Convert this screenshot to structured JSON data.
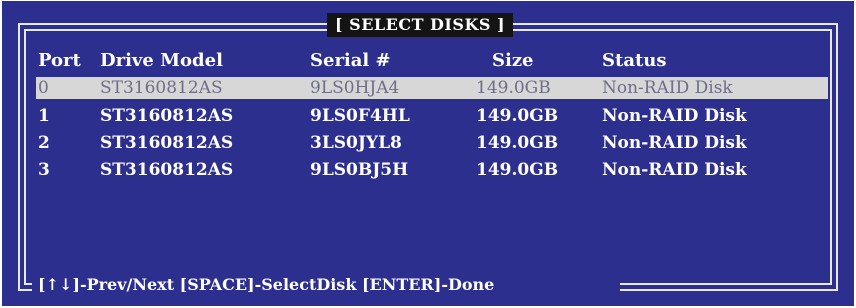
{
  "dialog": {
    "title": "[ SELECT DISKS ]"
  },
  "table": {
    "headers": {
      "port": "Port",
      "model": "Drive Model",
      "serial": "Serial #",
      "size": "Size",
      "status": "Status"
    },
    "rows": [
      {
        "port": "0",
        "model": "ST3160812AS",
        "serial": "9LS0HJA4",
        "size": "149.0GB",
        "status": "Non-RAID Disk",
        "selected": true
      },
      {
        "port": "1",
        "model": "ST3160812AS",
        "serial": "9LS0F4HL",
        "size": "149.0GB",
        "status": "Non-RAID Disk",
        "selected": false
      },
      {
        "port": "2",
        "model": "ST3160812AS",
        "serial": "3LS0JYL8",
        "size": "149.0GB",
        "status": "Non-RAID Disk",
        "selected": false
      },
      {
        "port": "3",
        "model": "ST3160812AS",
        "serial": "9LS0BJ5H",
        "size": "149.0GB",
        "status": "Non-RAID Disk",
        "selected": false
      }
    ]
  },
  "footer": {
    "hint": "[↑↓]-Prev/Next [SPACE]-SelectDisk [ENTER]-Done"
  },
  "colors": {
    "background": "#2c2f8e",
    "highlight": "#d7d7d7",
    "title_bg": "#141414"
  }
}
